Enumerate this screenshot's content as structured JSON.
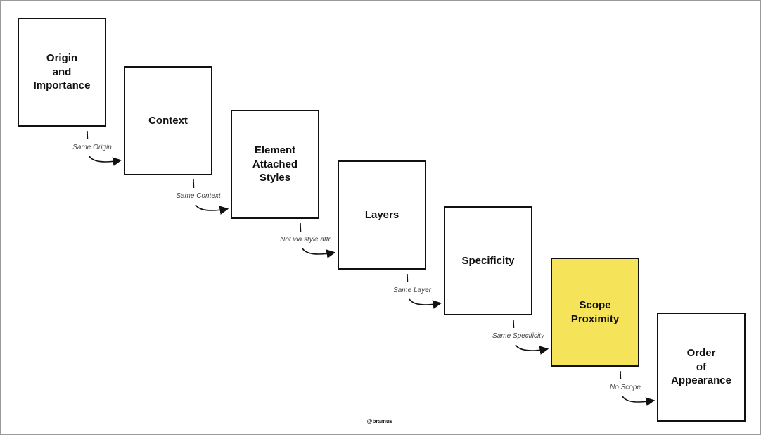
{
  "steps": [
    {
      "label": "Origin\nand\nImportance"
    },
    {
      "label": "Context"
    },
    {
      "label": "Element\nAttached\nStyles"
    },
    {
      "label": "Layers"
    },
    {
      "label": "Specificity"
    },
    {
      "label": "Scope\nProximity",
      "highlight": true
    },
    {
      "label": "Order\nof\nAppearance"
    }
  ],
  "transitions": [
    "Same Origin",
    "Same Context",
    "Not via style attr",
    "Same Layer",
    "Same Specificity",
    "No Scope"
  ],
  "credit": "@bramus",
  "colors": {
    "highlight": "#f5e35a",
    "border": "#111111"
  }
}
